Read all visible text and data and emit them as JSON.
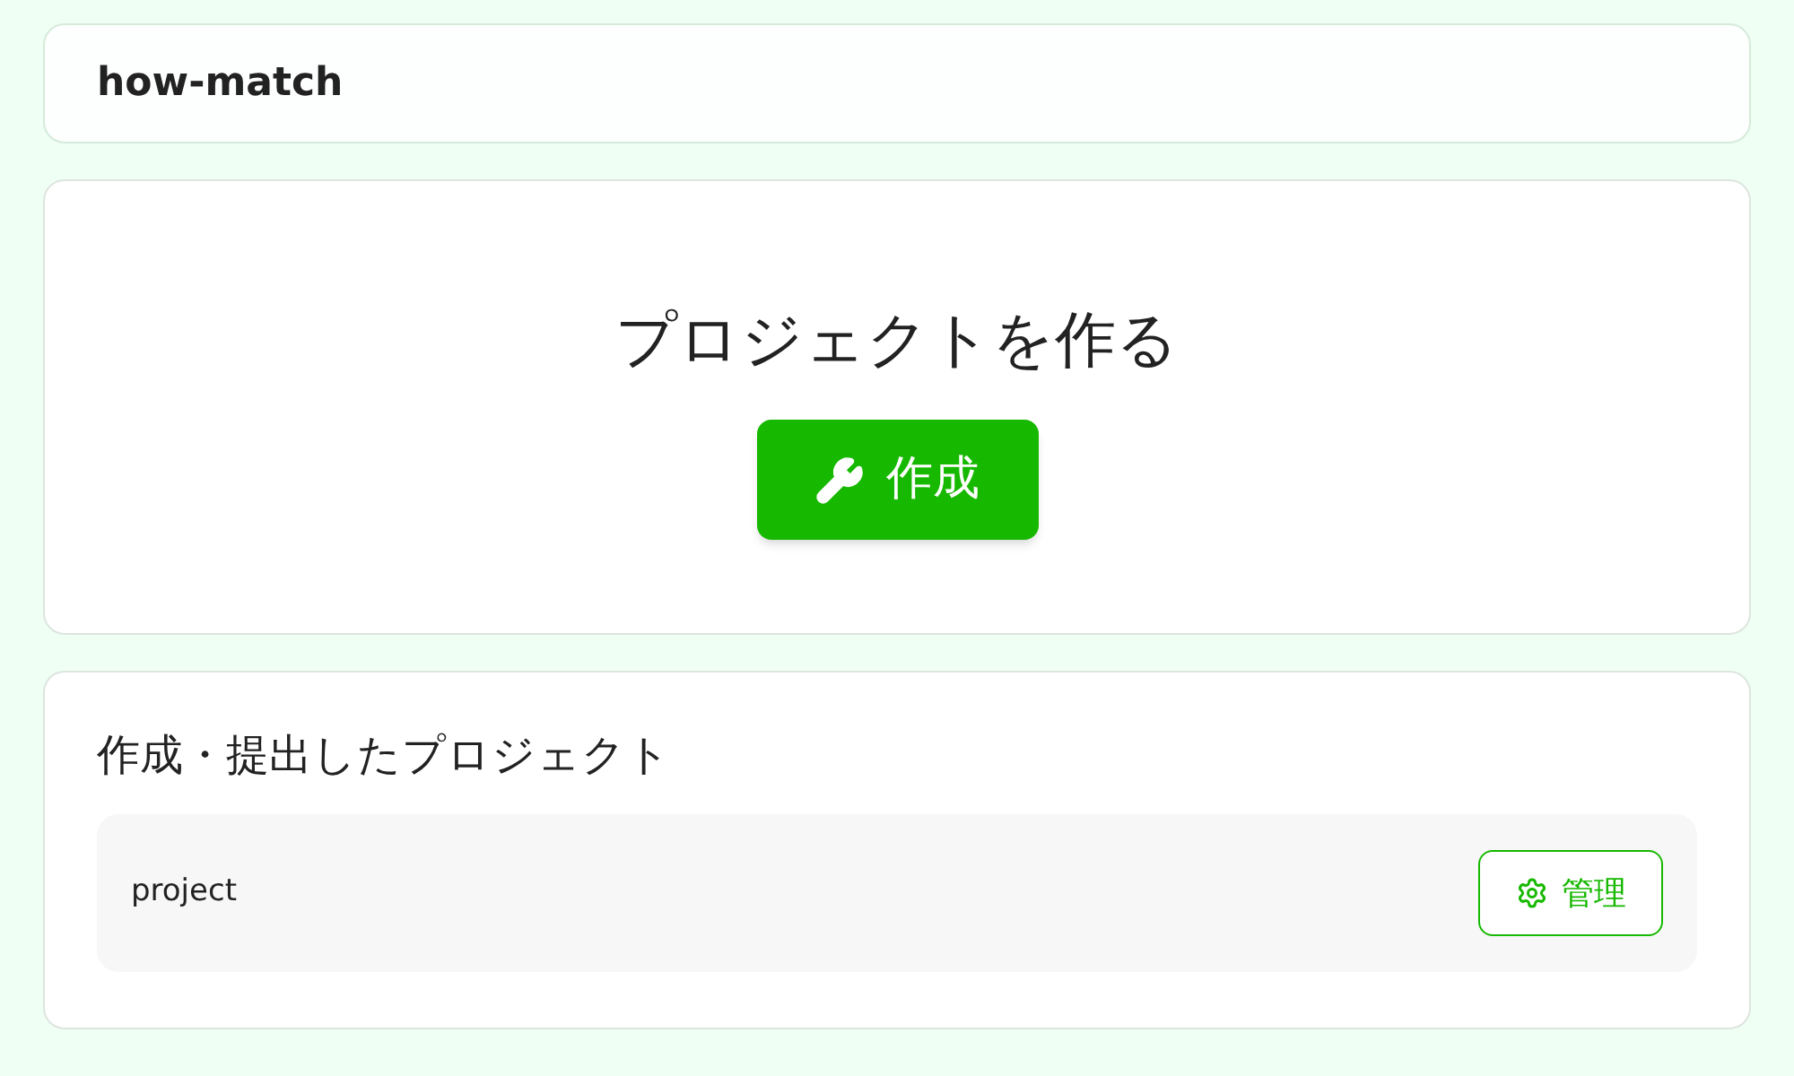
{
  "header": {
    "title": "how-match"
  },
  "create": {
    "heading": "プロジェクトを作る",
    "button": "作成"
  },
  "projects": {
    "heading": "作成・提出したプロジェクト",
    "items": [
      {
        "name": "project",
        "button": "管理"
      }
    ]
  }
}
